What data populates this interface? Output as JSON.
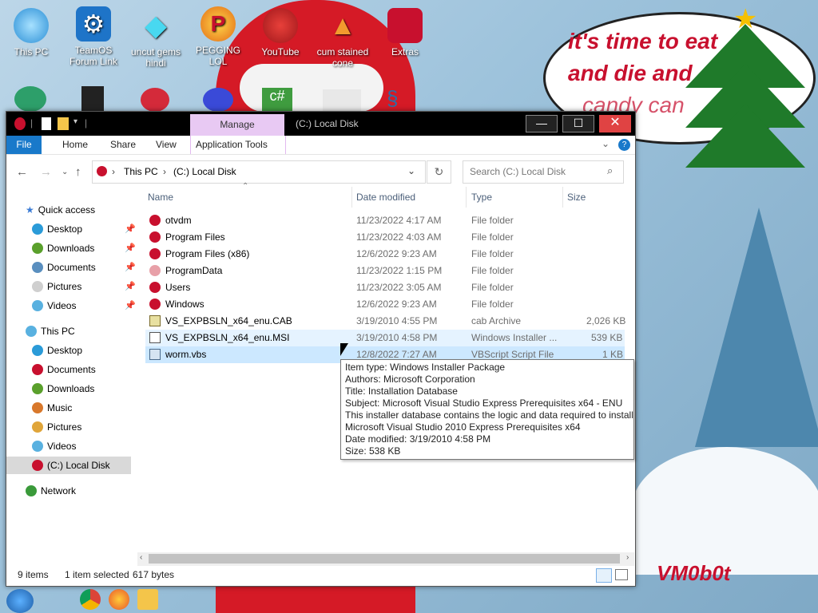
{
  "desktop": {
    "icons": [
      {
        "label": "This PC"
      },
      {
        "label": "TeamOS Forum Link"
      },
      {
        "label": "uncut gems hindi"
      },
      {
        "label": "PEGGING LOL"
      },
      {
        "label": "YouTube"
      },
      {
        "label": "cum stained cone"
      },
      {
        "label": "Extras"
      }
    ],
    "speech_bubble": {
      "line1": "it's time to eat",
      "line2": "and die and",
      "line3": "candy can"
    },
    "watermark": "VM0b0t"
  },
  "window": {
    "title": "(C:) Local Disk",
    "manage_tab": "Manage",
    "controls": {
      "minimize": "—",
      "maximize": "☐",
      "close": "✕"
    },
    "ribbon_tabs": [
      "File",
      "Home",
      "Share",
      "View",
      "Application Tools"
    ],
    "address": {
      "segments": [
        "This PC",
        "(C:) Local Disk"
      ],
      "separator": "›"
    },
    "search_placeholder": "Search (C:) Local Disk",
    "sidebar": [
      {
        "label": "Quick access",
        "color": "#3a7bd5"
      },
      {
        "label": "Desktop",
        "color": "#2b9bd8"
      },
      {
        "label": "Downloads",
        "color": "#5aa02c"
      },
      {
        "label": "Documents",
        "color": "#5a8fbf"
      },
      {
        "label": "Pictures",
        "color": "#cfcfcf"
      },
      {
        "label": "Videos",
        "color": "#59b1e0"
      },
      {
        "label": "This PC",
        "color": "#59b1e0"
      },
      {
        "label": "Desktop",
        "color": "#2b9bd8"
      },
      {
        "label": "Documents",
        "color": "#c8102e"
      },
      {
        "label": "Downloads",
        "color": "#5aa02c"
      },
      {
        "label": "Music",
        "color": "#d8782b"
      },
      {
        "label": "Pictures",
        "color": "#e0a53a"
      },
      {
        "label": "Videos",
        "color": "#59b1e0"
      },
      {
        "label": "(C:) Local Disk",
        "color": "#c8102e"
      },
      {
        "label": "Network",
        "color": "#3a9a3a"
      }
    ],
    "columns": [
      "Name",
      "Date modified",
      "Type",
      "Size"
    ],
    "files": [
      {
        "name": "otvdm",
        "date": "11/23/2022 4:17 AM",
        "type": "File folder",
        "size": ""
      },
      {
        "name": "Program Files",
        "date": "11/23/2022 4:03 AM",
        "type": "File folder",
        "size": ""
      },
      {
        "name": "Program Files (x86)",
        "date": "12/6/2022 9:23 AM",
        "type": "File folder",
        "size": ""
      },
      {
        "name": "ProgramData",
        "date": "11/23/2022 1:15 PM",
        "type": "File folder",
        "size": ""
      },
      {
        "name": "Users",
        "date": "11/23/2022 3:05 AM",
        "type": "File folder",
        "size": ""
      },
      {
        "name": "Windows",
        "date": "12/6/2022 9:23 AM",
        "type": "File folder",
        "size": ""
      },
      {
        "name": "VS_EXPBSLN_x64_enu.CAB",
        "date": "3/19/2010 4:55 PM",
        "type": "cab Archive",
        "size": "2,026 KB"
      },
      {
        "name": "VS_EXPBSLN_x64_enu.MSI",
        "date": "3/19/2010 4:58 PM",
        "type": "Windows Installer ...",
        "size": "539 KB"
      },
      {
        "name": "worm.vbs",
        "date": "12/8/2022 7:27 AM",
        "type": "VBScript Script File",
        "size": "1 KB"
      }
    ],
    "tooltip": [
      "Item type: Windows Installer Package",
      "Authors: Microsoft Corporation",
      "Title: Installation Database",
      "Subject: Microsoft Visual Studio Express Prerequisites x64 - ENU",
      "This installer database contains the logic and data required to install",
      "Microsoft Visual Studio 2010 Express Prerequisites x64",
      "Date modified: 3/19/2010 4:58 PM",
      "Size: 538 KB"
    ],
    "status": {
      "items": "9 items",
      "selected": "1 item selected",
      "bytes": "617 bytes"
    }
  },
  "colors": {
    "file_tab": "#1979ca",
    "manage_tab": "#e8c9f3",
    "close_button": "#e04343",
    "selection": "#cce8ff"
  }
}
